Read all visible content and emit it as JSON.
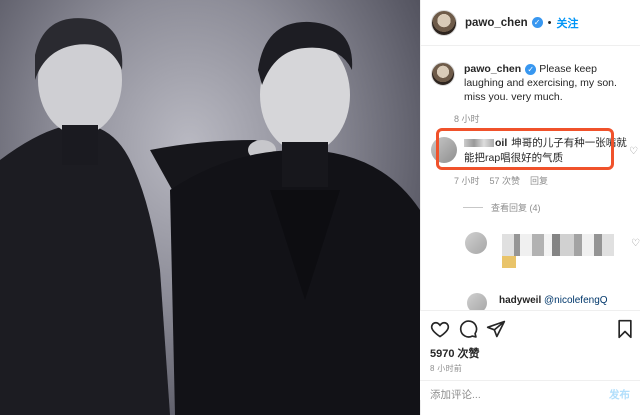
{
  "header": {
    "username": "pawo_chen",
    "verified_icon": "verified-badge-icon",
    "separator": "•",
    "follow_label": "关注"
  },
  "caption": {
    "username": "pawo_chen",
    "text": "Please keep laughing and exercising, my son. miss you. very much.",
    "time": "8 小时"
  },
  "comment": {
    "username_suffix": "oil",
    "text": "坤哥的儿子有种一张嘴就能把rap唱很好的气质",
    "time": "7 小时",
    "likes": "57 次赞",
    "reply_label": "回复",
    "view_replies": "查看回复 (4)"
  },
  "reply2": {
    "username": "hadyweil",
    "mention": "@nicolefengQ"
  },
  "actions": {
    "likes": "5970 次赞",
    "time": "8 小时前"
  },
  "add_comment": {
    "placeholder": "添加评论...",
    "post_label": "发布"
  },
  "colors": {
    "accent": "#0095f6",
    "highlight": "#f0522b"
  }
}
